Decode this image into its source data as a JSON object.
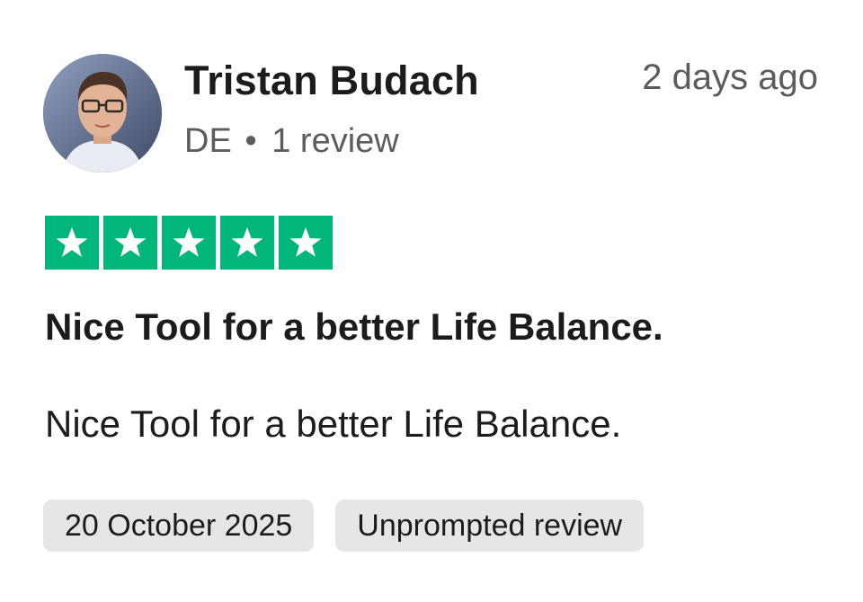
{
  "reviewer": {
    "name": "Tristan Budach",
    "country": "DE",
    "separator": "•",
    "review_count": "1 review",
    "avatar_icon": "person-photo"
  },
  "posted_ago": "2 days ago",
  "rating": {
    "stars": 5,
    "max": 5,
    "color": "#00b67a",
    "icon": "star-icon"
  },
  "review": {
    "title": "Nice Tool for a better Life Balance.",
    "body": "Nice Tool for a better Life Balance."
  },
  "tags": {
    "date": "20 October 2025",
    "type": "Unprompted review"
  }
}
